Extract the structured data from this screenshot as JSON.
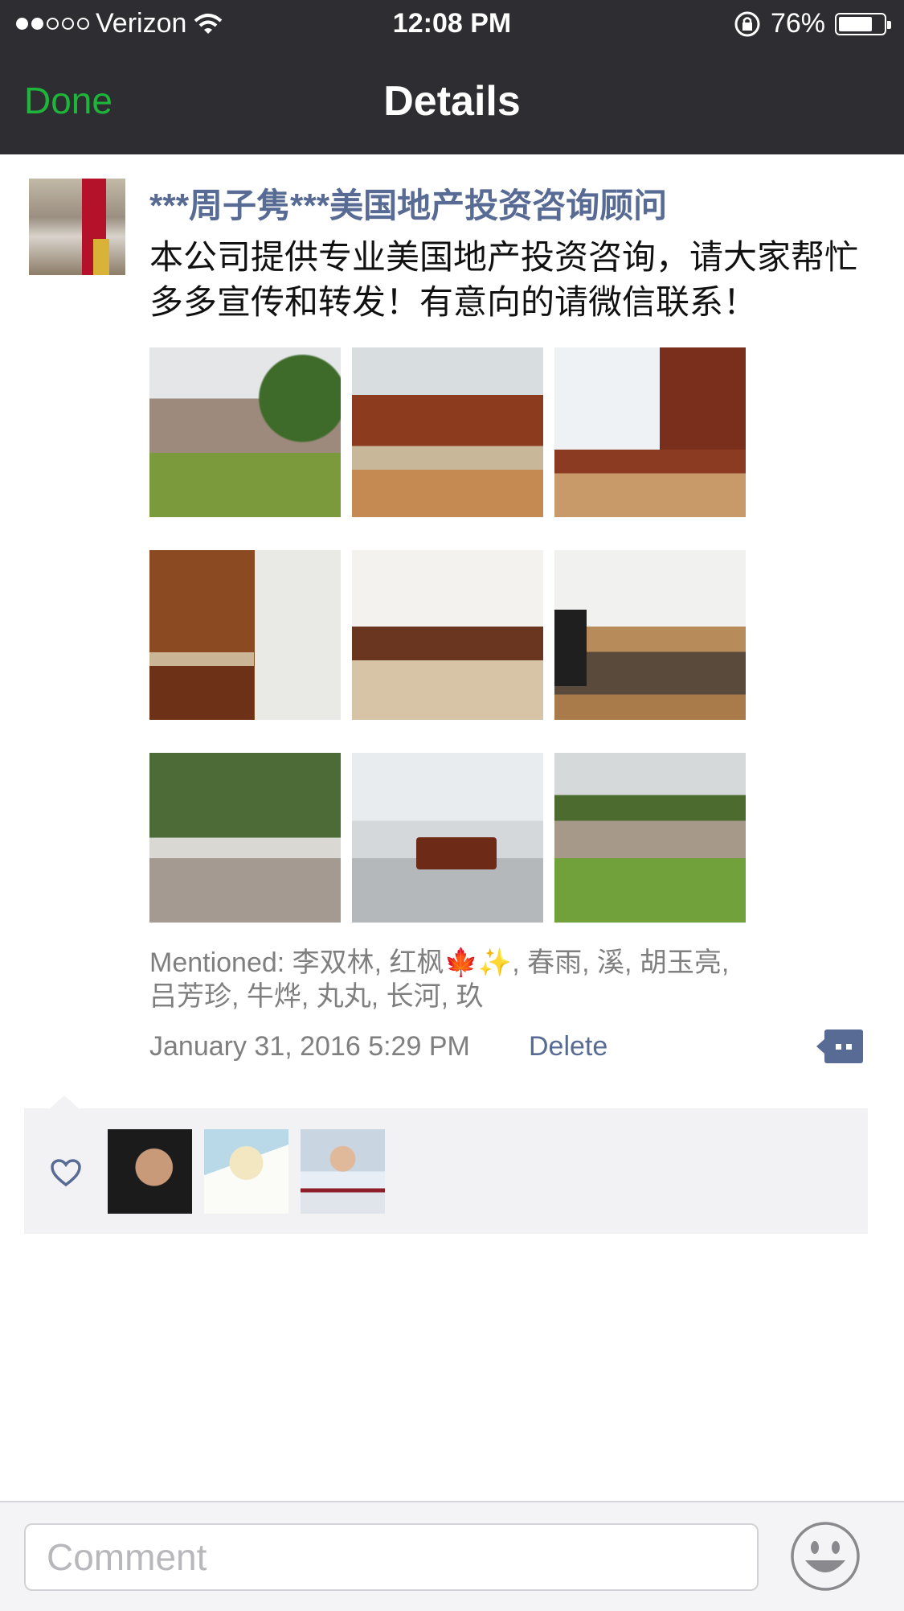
{
  "status_bar": {
    "carrier": "Verizon",
    "time": "12:08 PM",
    "battery": "76%",
    "battery_level": 0.76,
    "signal_bars": 2
  },
  "nav": {
    "done_label": "Done",
    "title": "Details"
  },
  "post": {
    "author": "***周子隽***美国地产投资咨询顾问",
    "text": "本公司提供专业美国地产投资咨询，请大家帮忙多多宣传和转发！有意向的请微信联系！",
    "photos": [
      "house-exterior-front",
      "kitchen",
      "kitchen-dining",
      "wine-rack-bar",
      "bathroom",
      "living-room",
      "deck-woods",
      "basement-pool-table",
      "house-exterior-rear"
    ],
    "mentioned": "Mentioned: 李双林, 红枫🍁✨, 春雨, 溪, 胡玉亮, 吕芳珍, 牛烨, 丸丸, 长河, 玖",
    "timestamp": "January 31, 2016 5:29 PM",
    "delete_label": "Delete"
  },
  "likes": {
    "count": 3
  },
  "comment_bar": {
    "placeholder": "Comment"
  },
  "colors": {
    "bar_background": "#2e2e32",
    "done_green": "#1db53a",
    "link_blue": "#576b95",
    "meta_gray": "#7f7f7f",
    "likes_background": "#f2f2f5"
  },
  "icons": {
    "wifi": "wifi-icon",
    "lock_rotation": "rotation-lock-icon",
    "battery": "battery-icon",
    "comment": "comment-bubble-icon",
    "like": "heart-icon",
    "emoji": "emoji-smiley-icon"
  }
}
